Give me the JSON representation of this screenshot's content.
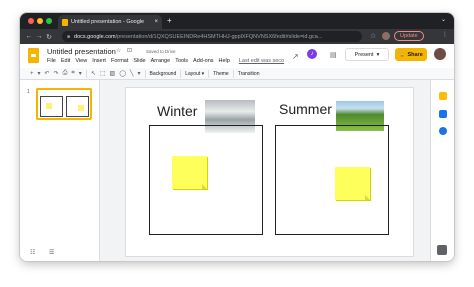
{
  "browser": {
    "tab_title": "Untitled presentation - Google",
    "tab_close": "×",
    "new_tab": "+",
    "tab_menu": "⌄",
    "url_host": "docs.google.com",
    "url_path": "/presentation/d/1QXQSUEEINDRe4HSMTHHJ-gpplXFQNVNSX6fedit#slide=id.gca...",
    "update_label": "Update",
    "nav_back": "←",
    "nav_forward": "→",
    "nav_reload": "↻",
    "star": "☆",
    "kebab": "⋮"
  },
  "header": {
    "doc_title": "Untitled presentation",
    "title_icons": "☆ ⊡",
    "saved_status": "Saved to Drive",
    "menus": [
      "File",
      "Edit",
      "View",
      "Insert",
      "Format",
      "Slide",
      "Arrange",
      "Tools",
      "Add-ons",
      "Help"
    ],
    "last_edit": "Last edit was seco",
    "trend_icon": "↗",
    "ext_icon": "♪",
    "comment_icon": "▤",
    "present_label": "Present",
    "present_caret": "▾",
    "share_label": "Share",
    "share_lock": "🔒"
  },
  "toolbar": {
    "icons_left": [
      "+",
      "▾",
      "↶",
      "↷",
      "⎙",
      "⌗",
      "▾"
    ],
    "icons_tools": [
      "↖",
      "⬚",
      "▨",
      "◯",
      "╲",
      "▾"
    ],
    "background_label": "Background",
    "layout_label": "Layout ▾",
    "theme_label": "Theme",
    "transition_label": "Transition"
  },
  "filmstrip": {
    "slide_number": "1",
    "footer_icons": "☷ ☰"
  },
  "slide": {
    "winter_label": "Winter",
    "summer_label": "Summer"
  },
  "colors": {
    "accent_yellow": "#f4b400",
    "sticky_yellow": "#ffff5c",
    "update_red": "#f28b82"
  }
}
